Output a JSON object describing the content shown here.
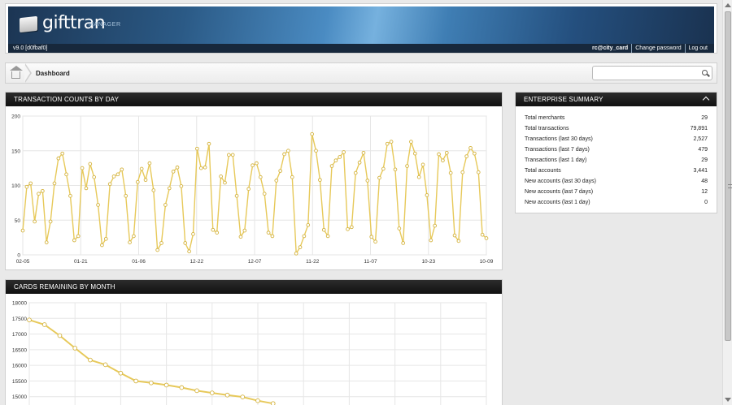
{
  "header": {
    "brand": "gifttran",
    "brand_sub": "MANAGER",
    "version": "v9.0 [d0fbaf0]",
    "user": "rc@city_card",
    "change_password": "Change password",
    "logout": "Log out"
  },
  "breadcrumb": {
    "current": "Dashboard"
  },
  "search": {
    "placeholder": ""
  },
  "transactions_panel": {
    "title": "TRANSACTION COUNTS BY DAY",
    "chart_data": {
      "type": "line",
      "title": "",
      "xlabel": "",
      "ylabel": "",
      "ylim": [
        0,
        200
      ],
      "yticks": [
        0,
        50,
        100,
        150,
        200
      ],
      "xtick_labels": [
        "02-05",
        "01-21",
        "01-06",
        "12-22",
        "12-07",
        "11-22",
        "11-07",
        "10-23",
        "10-09"
      ],
      "grid": true,
      "series_color": "#e7c95a",
      "values": [
        35,
        98,
        103,
        48,
        88,
        92,
        18,
        48,
        103,
        139,
        146,
        116,
        85,
        21,
        27,
        125,
        96,
        131,
        112,
        72,
        14,
        23,
        102,
        113,
        116,
        123,
        85,
        18,
        27,
        105,
        124,
        108,
        132,
        93,
        7,
        17,
        72,
        96,
        120,
        126,
        99,
        17,
        5,
        30,
        153,
        125,
        126,
        160,
        36,
        32,
        113,
        104,
        144,
        144,
        85,
        26,
        35,
        95,
        129,
        132,
        112,
        88,
        32,
        27,
        107,
        121,
        145,
        150,
        112,
        2,
        11,
        27,
        43,
        174,
        150,
        108,
        36,
        27,
        128,
        136,
        141,
        148,
        37,
        40,
        118,
        133,
        147,
        107,
        26,
        19,
        111,
        124,
        160,
        163,
        123,
        38,
        17,
        128,
        163,
        146,
        112,
        130,
        86,
        21,
        42,
        145,
        136,
        147,
        118,
        28,
        20,
        119,
        142,
        154,
        146,
        119,
        29,
        24
      ]
    }
  },
  "cards_panel": {
    "title": "CARDS REMAINING BY MONTH",
    "chart_data": {
      "type": "line",
      "title": "",
      "xlabel": "",
      "ylabel": "",
      "ylim": [
        14500,
        18000
      ],
      "yticks": [
        15000,
        15500,
        16000,
        16500,
        17000,
        17500,
        18000
      ],
      "grid": true,
      "series_color": "#e7c95a",
      "values": [
        17450,
        17300,
        16950,
        16550,
        16170,
        16020,
        15750,
        15500,
        15440,
        15370,
        15290,
        15190,
        15120,
        15050,
        14990,
        14870,
        14780
      ]
    }
  },
  "summary_panel": {
    "title": "ENTERPRISE SUMMARY",
    "rows": [
      {
        "label": "Total merchants",
        "value": "29"
      },
      {
        "label": "Total transactions",
        "value": "79,891"
      },
      {
        "label": "Transactions (last 30 days)",
        "value": "2,527"
      },
      {
        "label": "Transactions (last 7 days)",
        "value": "479"
      },
      {
        "label": "Transactions (last 1 day)",
        "value": "29"
      },
      {
        "label": "Total accounts",
        "value": "3,441"
      },
      {
        "label": "New accounts (last 30 days)",
        "value": "48"
      },
      {
        "label": "New accounts (last 7 days)",
        "value": "12"
      },
      {
        "label": "New accounts (last 1 day)",
        "value": "0"
      }
    ]
  }
}
